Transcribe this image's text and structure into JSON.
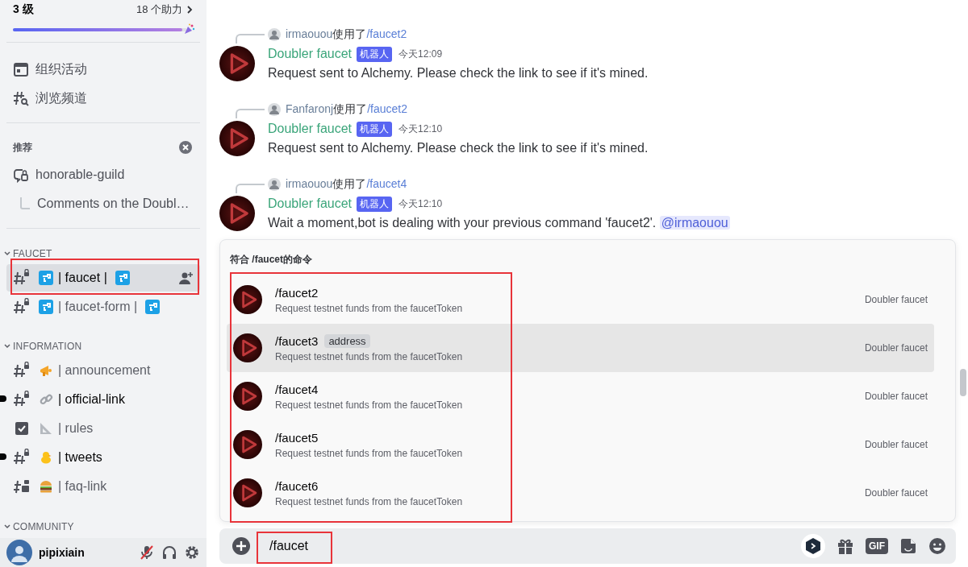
{
  "server_boost": {
    "level_label": "3 级",
    "boosts_label": "18 个助力",
    "level": 0.97
  },
  "sidebar": {
    "nav_items": [
      {
        "label": "组织活动",
        "kind": "events"
      },
      {
        "label": "浏览频道",
        "kind": "browse"
      }
    ],
    "recommended": {
      "title": "推荐",
      "items": [
        {
          "label": "honorable-guild",
          "kind": "forum"
        },
        {
          "label": "Comments on the Doubl…",
          "kind": "thread"
        }
      ]
    },
    "categories": [
      {
        "name": "FAUCET",
        "expanded": true,
        "channels": [
          {
            "name": "| faucet |",
            "kind": "text",
            "selected": true,
            "unread": false,
            "highlighted": true
          },
          {
            "name": "| faucet-form |",
            "kind": "text",
            "selected": false,
            "unread": false,
            "highlighted": false
          }
        ]
      },
      {
        "name": "INFORMATION",
        "expanded": true,
        "channels": [
          {
            "name": "| announcement",
            "kind": "text",
            "selected": false,
            "unread": false,
            "highlighted": false
          },
          {
            "name": "| official-link",
            "kind": "text",
            "selected": false,
            "unread": true,
            "highlighted": false
          },
          {
            "name": "| rules",
            "kind": "rules",
            "selected": false,
            "unread": false,
            "highlighted": false
          },
          {
            "name": "| tweets",
            "kind": "text",
            "selected": false,
            "unread": true,
            "highlighted": false
          },
          {
            "name": "| faq-link",
            "kind": "forum",
            "selected": false,
            "unread": false,
            "highlighted": false
          }
        ]
      },
      {
        "name": "COMMUNITY",
        "expanded": true
      }
    ]
  },
  "user": {
    "name": "pipixiain",
    "muted": true
  },
  "messages": [
    {
      "invoker": "irmaouou",
      "used_label": "使用了",
      "command": "/faucet2",
      "author": "Doubler faucet",
      "badge": "机器人",
      "time": "今天12:09",
      "content": "Request sent to Alchemy. Please check the link to see if it's mined."
    },
    {
      "invoker": "Fanfaronj",
      "used_label": "使用了",
      "command": "/faucet2",
      "author": "Doubler faucet",
      "badge": "机器人",
      "time": "今天12:10",
      "content": "Request sent to Alchemy. Please check the link to see if it's mined."
    },
    {
      "invoker": "irmaouou",
      "used_label": "使用了",
      "command": "/faucet4",
      "author": "Doubler faucet",
      "badge": "机器人",
      "time": "今天12:10",
      "content": "Wait a moment,bot is dealing with your previous command 'faucet2'.",
      "mention": "@irmaouou"
    }
  ],
  "command_popup": {
    "title": "符合 /faucet的命令",
    "highlighted": true,
    "commands": [
      {
        "name": "/faucet2",
        "description": "Request testnet funds from the faucetToken",
        "source": "Doubler faucet",
        "selected": false
      },
      {
        "name": "/faucet3",
        "option": "address",
        "description": "Request testnet funds from the faucetToken",
        "source": "Doubler faucet",
        "selected": true
      },
      {
        "name": "/faucet4",
        "description": "Request testnet funds from the faucetToken",
        "source": "Doubler faucet",
        "selected": false
      },
      {
        "name": "/faucet5",
        "description": "Request testnet funds from the faucetToken",
        "source": "Doubler faucet",
        "selected": false
      },
      {
        "name": "/faucet6",
        "description": "Request testnet funds from the faucetToken",
        "source": "Doubler faucet",
        "selected": false
      }
    ]
  },
  "composer": {
    "value": "/faucet",
    "highlighted": true,
    "gif_label": "GIF"
  }
}
